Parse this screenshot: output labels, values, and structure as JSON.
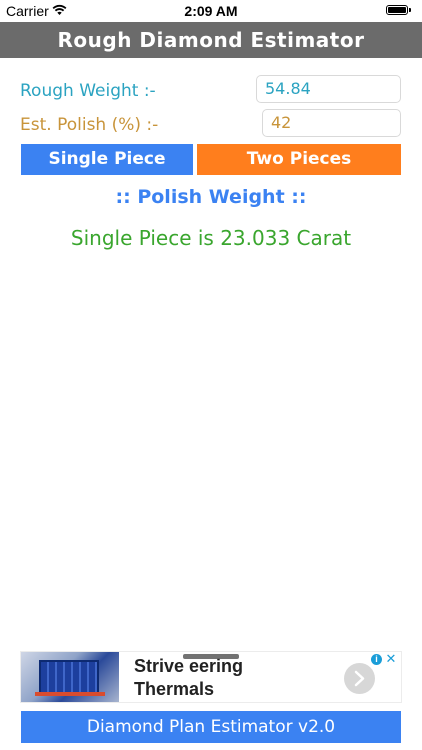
{
  "status_bar": {
    "carrier": "Carrier",
    "time": "2:09 AM"
  },
  "header": {
    "title": "Rough Diamond Estimator"
  },
  "form": {
    "rough_weight_label": "Rough Weight :-",
    "rough_weight_value": "54.84",
    "est_polish_label": "Est. Polish (%) :-",
    "est_polish_value": "42"
  },
  "buttons": {
    "single_piece": "Single Piece",
    "two_pieces": "Two Pieces"
  },
  "result": {
    "header": ":: Polish Weight ::",
    "text": "Single Piece is 23.033 Carat"
  },
  "ad": {
    "line1": "Strive    eering",
    "line2": "Thermals"
  },
  "footer": {
    "label": "Diamond Plan Estimator v2.0"
  },
  "colors": {
    "title_bar": "#6b6b6b",
    "rough_weight": "#2ba3c1",
    "est_polish": "#c8943a",
    "single_button": "#3b82f2",
    "two_button": "#ff7e1d",
    "result_text": "#3aa62e",
    "footer": "#3b82f2"
  },
  "icons": {
    "wifi": "wifi-icon",
    "battery": "battery-icon",
    "ad_info": "info-icon",
    "ad_close": "close-icon",
    "ad_next": "chevron-right-icon"
  }
}
